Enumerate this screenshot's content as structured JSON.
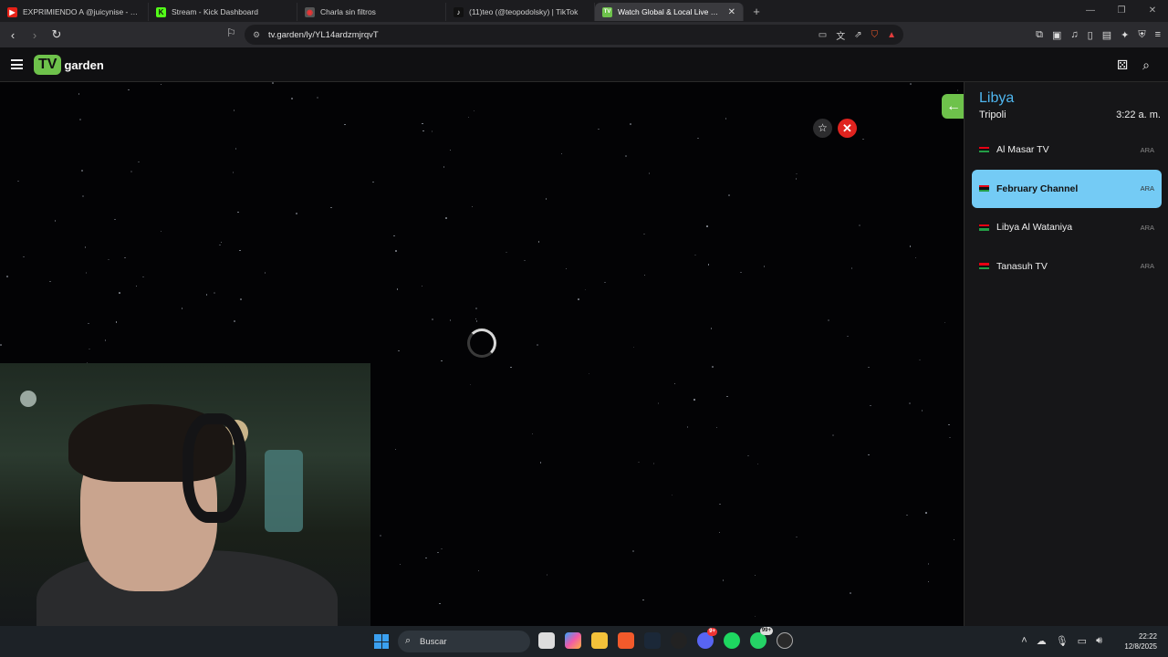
{
  "browser": {
    "tabs": [
      {
        "title": "EXPRIMIENDO A @juicynise - YouTube",
        "favicon_color": "#e62117",
        "favicon_glyph": "▶",
        "active": false
      },
      {
        "title": "Stream - Kick Dashboard",
        "favicon_color": "#53fc18",
        "favicon_glyph": "K",
        "active": false
      },
      {
        "title": "Charla sin filtros",
        "favicon_color": "#555555",
        "favicon_glyph": "◉",
        "active": false
      },
      {
        "title": "(11)teo (@teopodolsky) | TikTok",
        "favicon_color": "#111111",
        "favicon_glyph": "♪",
        "active": false
      },
      {
        "title": "Watch Global & Local Live TV Online",
        "favicon_color": "#6ec24b",
        "favicon_glyph": "TV",
        "active": true
      }
    ],
    "new_tab": "+",
    "url": "tv.garden/ly/YL14ardzmjrqvT"
  },
  "app": {
    "logo_tv": "TV",
    "logo_garden": "garden",
    "accent_color": "#6ec24b"
  },
  "player": {
    "favorite_icon": "☆",
    "close_icon": "✕"
  },
  "panel": {
    "back_icon": "←",
    "country": "Libya",
    "city": "Tripoli",
    "local_time": "3:22 a. m.",
    "channels": [
      {
        "name": "Al Masar TV",
        "lang": "ARA",
        "selected": false
      },
      {
        "name": "February Channel",
        "lang": "ARA",
        "selected": true
      },
      {
        "name": "Libya Al Wataniya",
        "lang": "ARA",
        "selected": false
      },
      {
        "name": "Tanasuh TV",
        "lang": "ARA",
        "selected": false
      }
    ]
  },
  "taskbar": {
    "search_placeholder": "Buscar",
    "time": "22:22",
    "date": "12/8/2025",
    "discord_badge": "9+",
    "whatsapp_badge": "99+"
  }
}
